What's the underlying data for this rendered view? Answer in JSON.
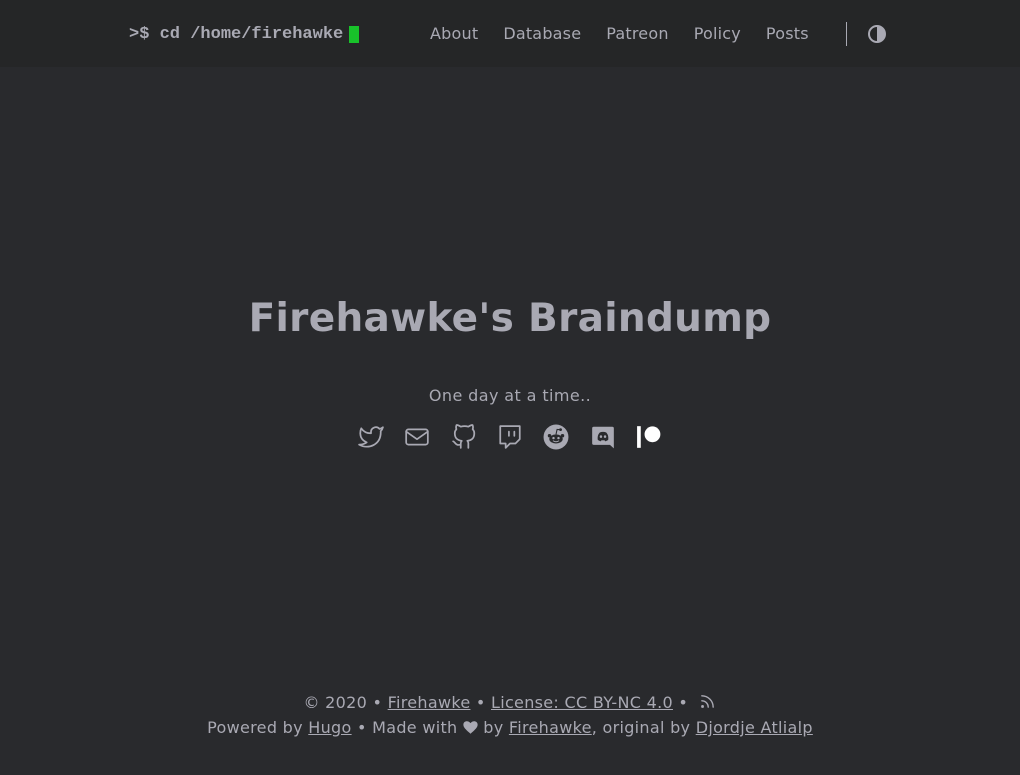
{
  "header": {
    "logo_prompt": ">$ cd /home/firehawke",
    "menu": [
      {
        "label": "About"
      },
      {
        "label": "Database"
      },
      {
        "label": "Patreon"
      },
      {
        "label": "Policy"
      },
      {
        "label": "Posts"
      }
    ],
    "theme_toggle_icon": "contrast-icon",
    "cursor_color": "#18c22a"
  },
  "main": {
    "title": "Firehawke's Braindump",
    "tagline": "One day at a time..",
    "socials": [
      {
        "icon": "twitter-icon"
      },
      {
        "icon": "email-icon"
      },
      {
        "icon": "github-icon"
      },
      {
        "icon": "twitch-icon"
      },
      {
        "icon": "reddit-icon"
      },
      {
        "icon": "discord-icon"
      },
      {
        "icon": "patreon-icon"
      }
    ]
  },
  "footer": {
    "copyright": "© 2020",
    "bullet": "•",
    "author_link": "Firehawke",
    "license_link": "License: CC BY-NC 4.0",
    "rss_icon": "rss-icon",
    "powered_by": "Powered by",
    "hugo_link": "Hugo",
    "made_with": "Made with",
    "heart_icon": "heart-icon",
    "by": "by",
    "made_by_link": "Firehawke",
    "original_by": ", original by",
    "theme_author_link": "Djordje Atlialp"
  },
  "colors": {
    "background": "#292a2d",
    "header_background": "#252627",
    "text": "#a9a9b3",
    "accent": "#18c22a"
  }
}
